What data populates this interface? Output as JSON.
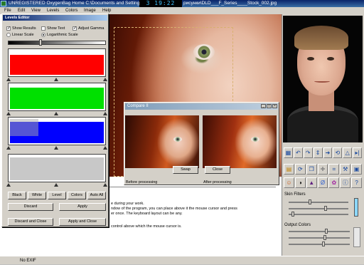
{
  "window": {
    "title_left": "UNREGISTERED OxygenBag Home  C:\\Documents and Setting",
    "title_right": "рисунки\\DLD___F_Series____Stock_002.jpg",
    "clock": "3 19:22"
  },
  "menu": [
    "File",
    "Edit",
    "View",
    "Levels",
    "Colors",
    "Image",
    "Help"
  ],
  "levels_editor": {
    "title": "Levels Editor",
    "show_results": "Show Results",
    "show_text": "Show Text",
    "adjust_gamma": "Adjust Gamma",
    "linear_scale": "Linear Scale",
    "log_scale": "Logarithmic Scale",
    "checks": {
      "show_results": true,
      "show_text": false,
      "adjust_gamma": true
    },
    "scale_selected": "log",
    "channels": [
      {
        "name": "red",
        "color": "#ff0000"
      },
      {
        "name": "green",
        "color": "#00e000"
      },
      {
        "name": "blue",
        "color": "#0000ff"
      },
      {
        "name": "luminance",
        "color": "#c8c8c8"
      }
    ],
    "buttons": {
      "black": "Black",
      "white": "White",
      "level": "Level",
      "colors": "Colors",
      "auto_all": "Auto All",
      "discard": "Discard",
      "apply": "Apply",
      "discard_close": "Discard and Close",
      "apply_close": "Apply and Close"
    }
  },
  "compare": {
    "title": "Compare II",
    "before_label": "Before processing",
    "after_label": "After processing",
    "swap": "Swap",
    "close": "Close"
  },
  "text_panel": {
    "lines": [
      "e during your work.",
      "ndow of the program, you can place above it the mouse cursor and press",
      "er once. The keyboard layout can be any.",
      "control above which the mouse cursor is."
    ]
  },
  "right_panel": {
    "skin_filters": "Skin Filters",
    "output_colors": "Output Colors"
  },
  "status": {
    "exif": "No EXIF"
  }
}
